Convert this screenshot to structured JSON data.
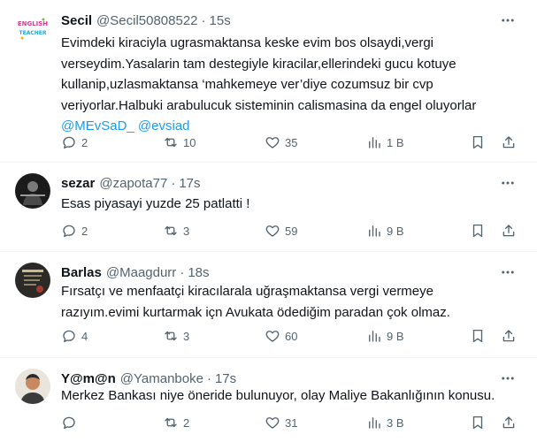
{
  "tweets": [
    {
      "name": "Secil",
      "handle": "@Secil50808522",
      "dot": "·",
      "time": "15s",
      "avatar_text": "ENGLISH TEACHER",
      "text_lines": [
        "Evimdeki kiraciyla ugrasmaktansa keske evim bos olsaydi,vergi",
        "verseydim.Yasalarin tam destegiyle kiracilar,ellerindeki gucu kotuye",
        "kullanip,uzlasmaktansa ‘mahkemeye ver’diye cozumsuz bir cvp",
        "veriyorlar.Halbuki arabulucuk sisteminin calismasina da engel oluyorlar"
      ],
      "mention1": "@MEvSaD_",
      "mention2": "@evsiad",
      "replies": "2",
      "retweets": "10",
      "likes": "35",
      "views": "1 B"
    },
    {
      "name": "sezar",
      "handle": "@zapota77",
      "dot": "·",
      "time": "17s",
      "text_lines": [
        "Esas piyasayi yuzde 25 patlatti !"
      ],
      "replies": "2",
      "retweets": "3",
      "likes": "59",
      "views": "9 B"
    },
    {
      "name": "Barlas",
      "handle": "@Maagdurr",
      "dot": "·",
      "time": "18s",
      "text_lines": [
        "Fırsatçı ve menfaatçi kiracılarala uğraşmaktansa vergi vermeye",
        "razıyım.evimi kurtarmak içn  Avukata ödediğim paradan çok olmaz."
      ],
      "replies": "4",
      "retweets": "3",
      "likes": "60",
      "views": "9 B"
    },
    {
      "name": "Y@m@n",
      "handle": "@Yamanboke",
      "dot": "·",
      "time": "17s",
      "text_lines": [
        "Merkez Bankası niye öneride bulunuyor, olay Maliye Bakanlığının konusu."
      ],
      "replies": "",
      "retweets": "2",
      "likes": "31",
      "views": "3 B"
    }
  ]
}
